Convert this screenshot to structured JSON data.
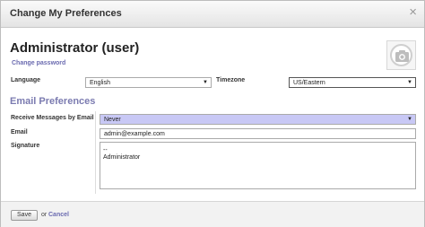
{
  "dialog": {
    "title": "Change My Preferences",
    "close_glyph": "×"
  },
  "user": {
    "name": "Administrator (user)",
    "change_password_label": "Change password",
    "avatar_icon": "camera-icon"
  },
  "preferences": {
    "language_label": "Language",
    "language_value": "English",
    "timezone_label": "Timezone",
    "timezone_value": "US/Eastern"
  },
  "email_prefs": {
    "section_title": "Email Preferences",
    "receive_label": "Receive Messages by Email",
    "receive_value": "Never",
    "email_label": "Email",
    "email_value": "admin@example.com",
    "signature_label": "Signature",
    "signature_value": "--\nAdministrator"
  },
  "footer": {
    "save_label": "Save",
    "or_text": "or",
    "cancel_label": "Cancel"
  },
  "colors": {
    "link": "#6b6bb0",
    "selected_field": "#c8c8f5"
  }
}
